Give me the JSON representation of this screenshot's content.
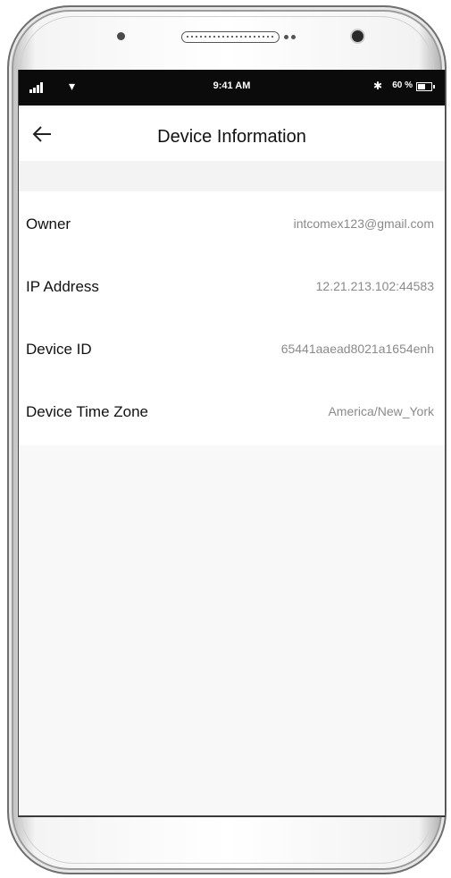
{
  "status_bar": {
    "time": "9:41 AM",
    "battery_percent": "60 %",
    "battery_level": 0.6,
    "wifi_icon": "wifi-icon",
    "bluetooth_icon": "bluetooth-icon"
  },
  "header": {
    "title": "Device Information",
    "back_icon": "arrow-left-icon"
  },
  "rows": [
    {
      "label": "Owner",
      "value": "intcomex123@gmail.com"
    },
    {
      "label": "IP Address",
      "value": "12.21.213.102:44583"
    },
    {
      "label": "Device ID",
      "value": "65441aaead8021a1654enh"
    },
    {
      "label": "Device Time Zone",
      "value": "America/New_York"
    }
  ],
  "colors": {
    "status_bar_bg": "#0b0b0b",
    "value_text": "#8a8a8a",
    "screen_bg": "#f8f8f8"
  }
}
